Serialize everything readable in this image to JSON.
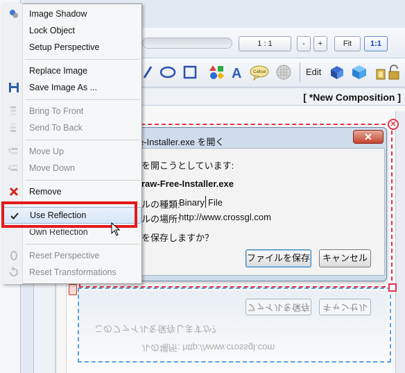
{
  "toolbar": {
    "zoom_ratio": "1 : 1",
    "zoom_minus": "-",
    "zoom_plus": "+",
    "fit_label": "Fit",
    "one_to_one_label": "1:1",
    "edit_label": "Edit"
  },
  "composition_title": "[ *New Composition ]",
  "dialog": {
    "title": "e-Installer.exe を開く",
    "close": "✕",
    "line1": "を開こうとしています:",
    "filename": "raw-Free-Installer.exe",
    "type_label": "ルの種類:",
    "type_value_a": "Binary",
    "type_value_b": "File",
    "location_label": "ルの場所:",
    "location_value": "http://www.crossgl.com",
    "question": "を保存しますか？",
    "save_button": "ファイルを保存",
    "cancel_button": "キャンセル"
  },
  "reflection": {
    "save_button": "ファイルを保存",
    "cancel_button": "キャンセル",
    "question": "このファイルを保存しますか？",
    "location": "ルの場所:  http://www.crossgl.com"
  },
  "menu": {
    "items": [
      {
        "label": "Image Shadow",
        "icon": "shadow-icon",
        "disabled": false
      },
      {
        "label": "Lock Object",
        "icon": "",
        "disabled": false
      },
      {
        "label": "Setup Perspective",
        "icon": "",
        "disabled": false
      },
      {
        "label": "Replace Image",
        "icon": "",
        "disabled": false
      },
      {
        "label": "Save Image As ...",
        "icon": "floppy-icon",
        "disabled": false
      },
      {
        "label": "Bring To Front",
        "icon": "bring-front-icon",
        "disabled": true
      },
      {
        "label": "Send To Back",
        "icon": "send-back-icon",
        "disabled": true
      },
      {
        "label": "Move Up",
        "icon": "move-up-icon",
        "disabled": true
      },
      {
        "label": "Move Down",
        "icon": "move-down-icon",
        "disabled": true
      },
      {
        "label": "Remove",
        "icon": "remove-icon",
        "disabled": false
      },
      {
        "label": "Use Reflection",
        "icon": "check-icon",
        "disabled": false,
        "checked": true
      },
      {
        "label": "Reset Perspective",
        "icon": "reset-perspective-icon",
        "disabled": true
      },
      {
        "label": "Reset Transformations",
        "icon": "reset-transform-icon",
        "disabled": true
      }
    ],
    "obscured_next": "Own Reflection"
  },
  "colors": {
    "highlight_border": "#e31a1a",
    "selection_red": "#e0334b",
    "reflection_blue": "#5aa0e0"
  }
}
